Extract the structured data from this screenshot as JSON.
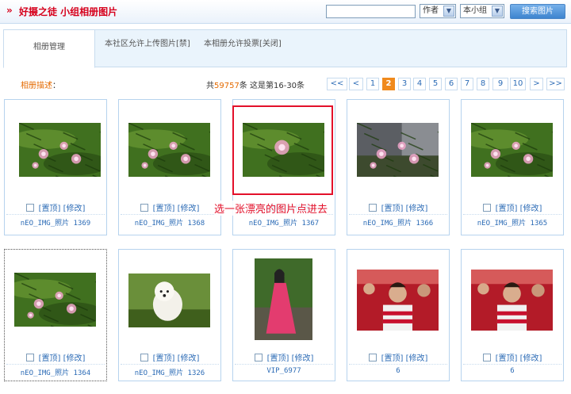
{
  "header": {
    "title": "好摄之徒  小组相册图片",
    "search_value": "",
    "author_select": "作者",
    "scope_select": "本小组",
    "search_button": "搜索图片"
  },
  "tabs": {
    "manage": "相册管理",
    "upload_setting": "本社区允许上传图片[禁]",
    "vote_setting": "本相册允许投票[关闭]"
  },
  "info": {
    "desc_label": "相册描述",
    "desc_colon": "：",
    "count_prefix": "共",
    "count_num": "59757",
    "count_suffix": "条 这是第16-30条"
  },
  "pager": [
    "<<",
    "<",
    "1",
    "2",
    "3",
    "4",
    "5",
    "6",
    "7",
    "8",
    "9",
    "10",
    ">",
    ">>"
  ],
  "pager_current": "2",
  "action_top": "[置顶]",
  "action_edit": "[修改]",
  "photos": [
    {
      "caption": "nEO_IMG_照片 1369"
    },
    {
      "caption": "nEO_IMG_照片 1368"
    },
    {
      "caption": "nEO_IMG_照片 1367"
    },
    {
      "caption": "nEO_IMG_照片 1366"
    },
    {
      "caption": "nEO_IMG_照片 1365"
    },
    {
      "caption": "nEO_IMG_照片 1364"
    },
    {
      "caption": "nEO_IMG_照片 1326"
    },
    {
      "caption": "VIP_6977"
    },
    {
      "caption": "6"
    },
    {
      "caption": "6"
    }
  ],
  "annotation": "选一张漂亮的图片点进去",
  "colors": {
    "accent": "#e3102a",
    "link": "#2d6cb6",
    "orange": "#f08a1d"
  }
}
